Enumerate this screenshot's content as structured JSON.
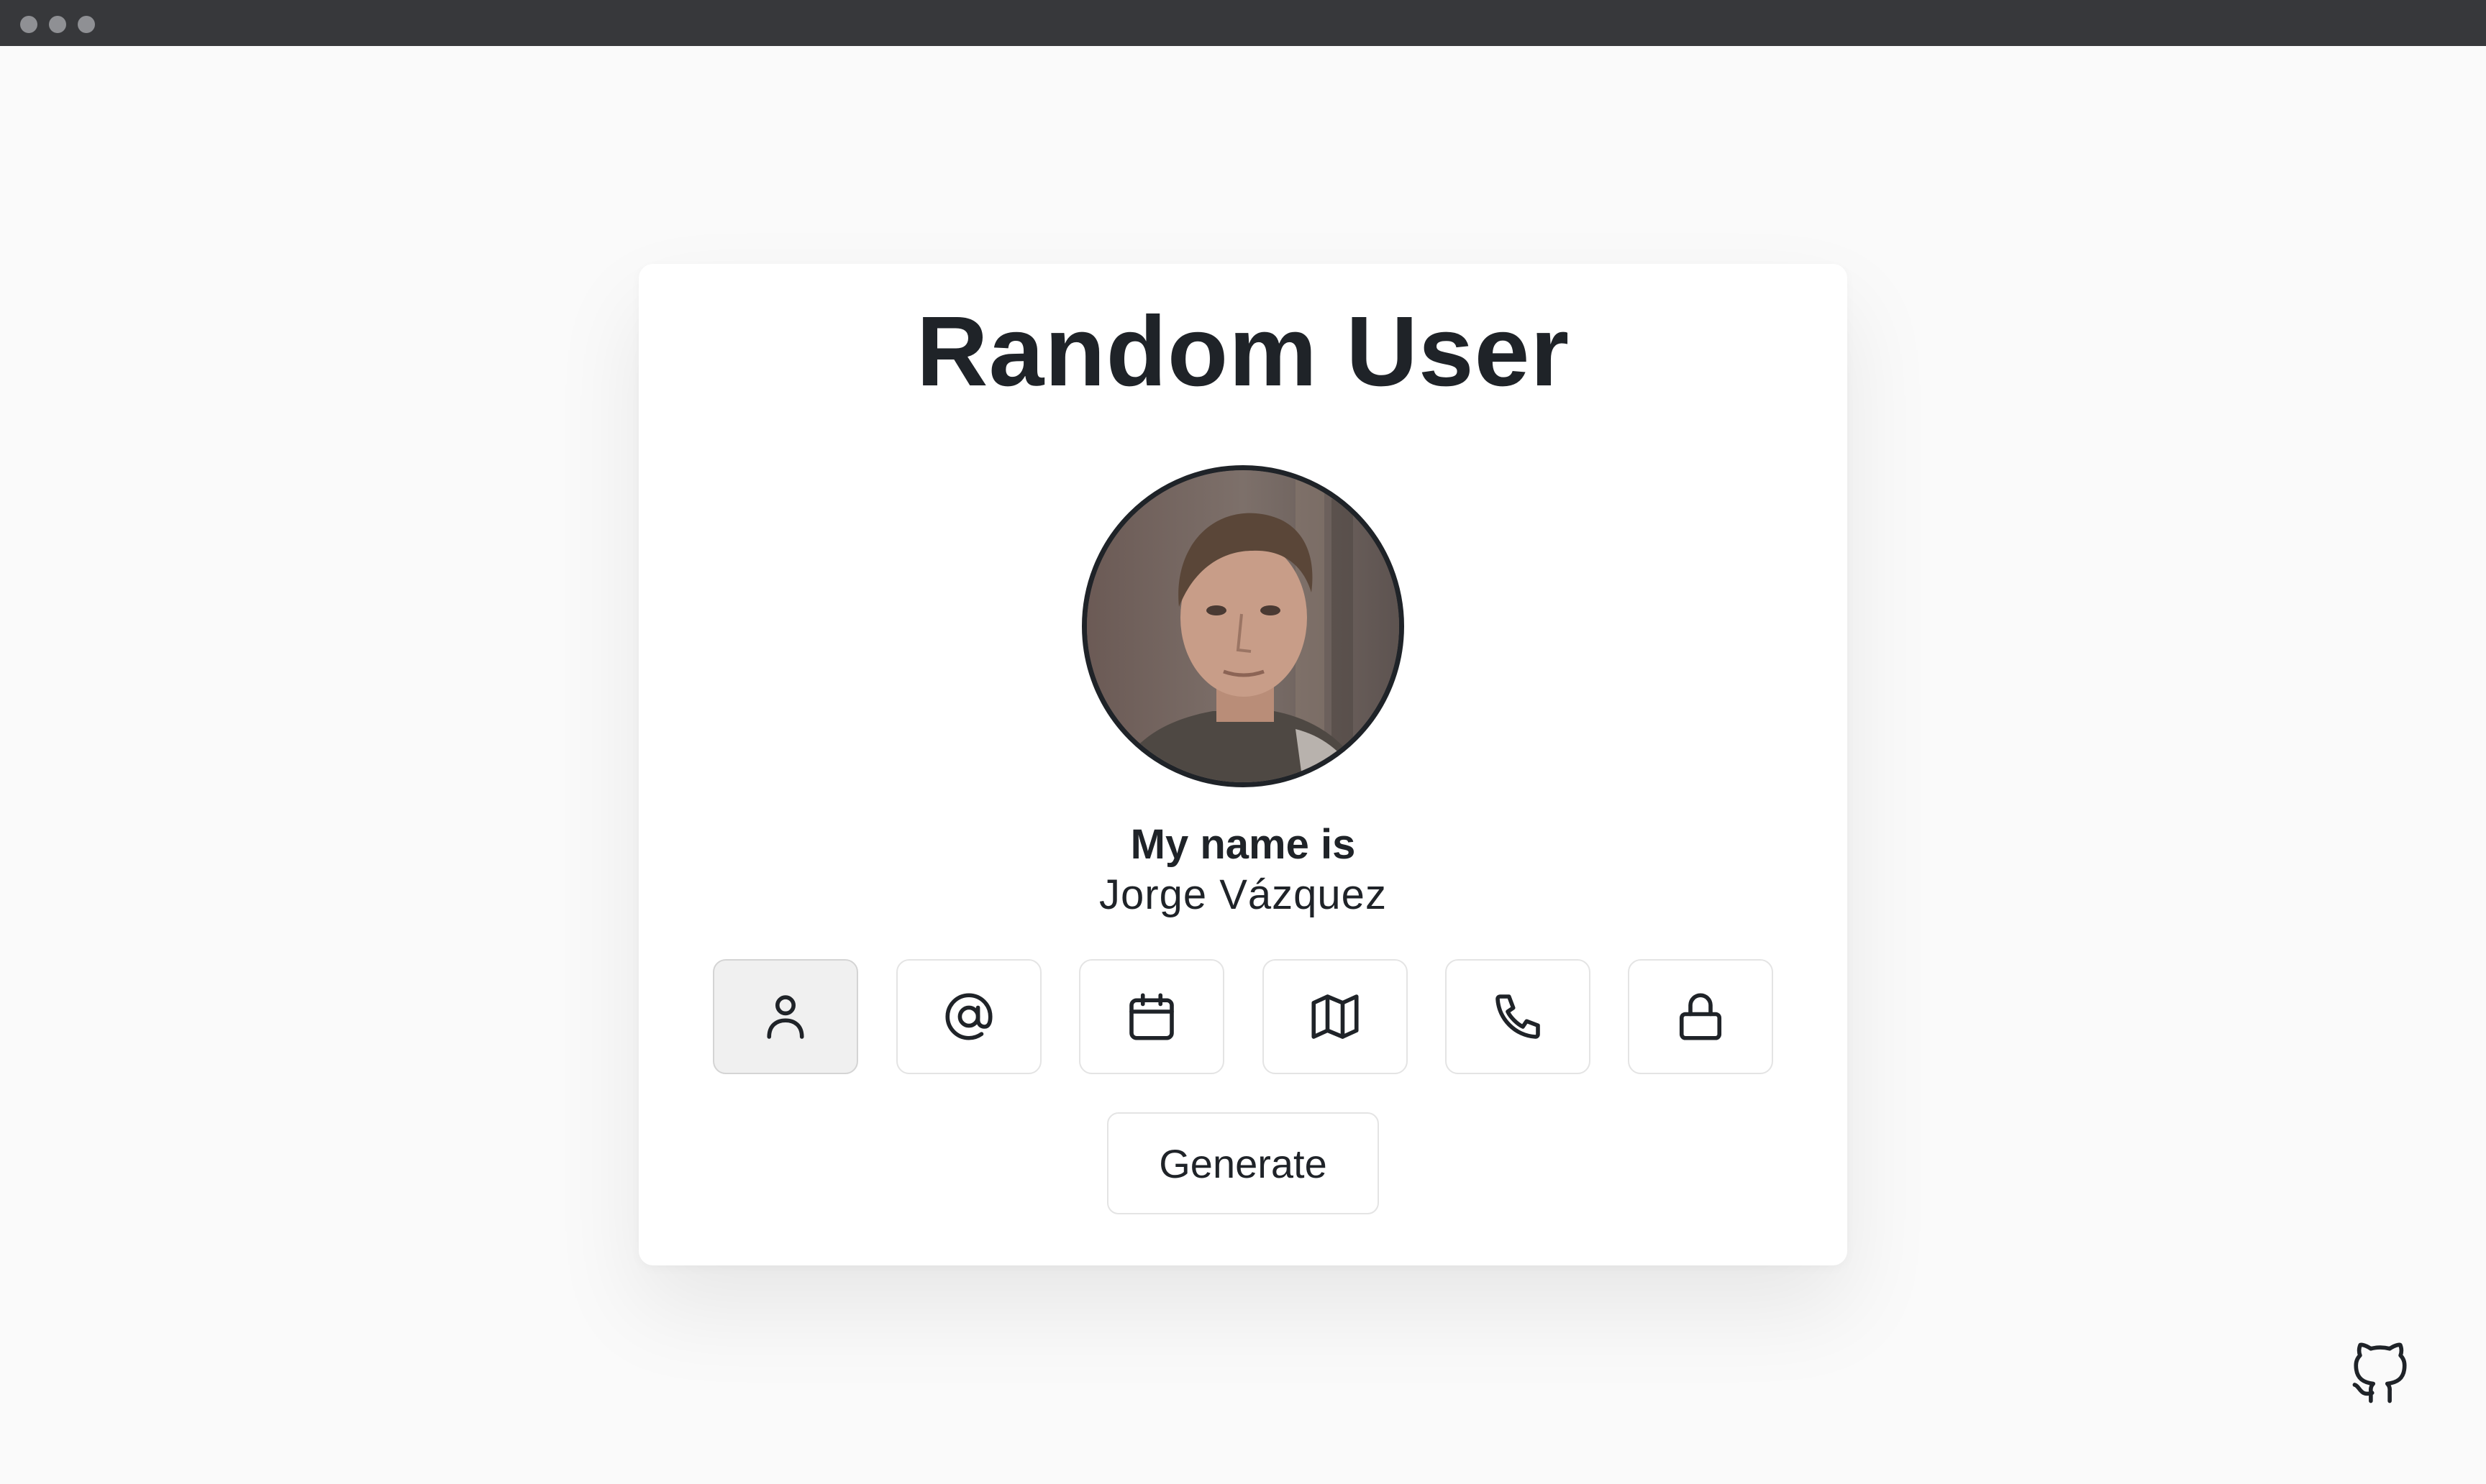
{
  "app": {
    "title": "Random User"
  },
  "profile": {
    "label": "My name is",
    "value": "Jorge Vázquez"
  },
  "info_buttons": [
    {
      "icon": "user-icon",
      "active": true
    },
    {
      "icon": "at-sign-icon",
      "active": false
    },
    {
      "icon": "calendar-icon",
      "active": false
    },
    {
      "icon": "map-icon",
      "active": false
    },
    {
      "icon": "phone-icon",
      "active": false
    },
    {
      "icon": "lock-icon",
      "active": false
    }
  ],
  "actions": {
    "generate_label": "Generate"
  },
  "footer": {
    "icon": "github-icon"
  },
  "colors": {
    "page_bg": "#fafafa",
    "card_bg": "#ffffff",
    "text": "#1f2328",
    "titlebar": "#37383b",
    "active_button_bg": "#f0f0f0"
  }
}
